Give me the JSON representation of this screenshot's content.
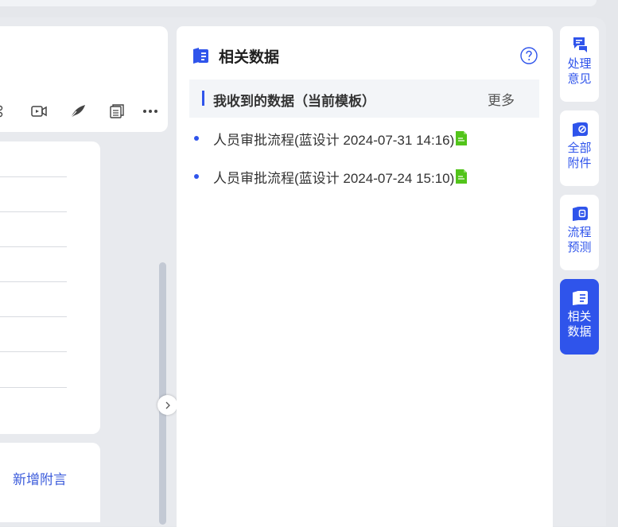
{
  "colors": {
    "accent": "#2f54eb",
    "doc_green": "#52c41a"
  },
  "toolbar": {
    "icons": [
      "org-chart-icon",
      "video-icon",
      "feather-icon",
      "copy-document-icon",
      "more-icon"
    ]
  },
  "form": {
    "add_note_label": "新增附言"
  },
  "panel": {
    "title": "相关数据",
    "section_title": "我收到的数据（当前模板）",
    "more_label": "更多",
    "records": [
      {
        "text": "人员审批流程(蓝设计 2024-07-31 14:16)"
      },
      {
        "text": "人员审批流程(蓝设计 2024-07-24 15:10)"
      }
    ]
  },
  "side_tabs": [
    {
      "label": "处理意见",
      "icon": "comment-flag-icon",
      "active": false
    },
    {
      "label": "全部附件",
      "icon": "attachment-icon",
      "active": false
    },
    {
      "label": "流程预测",
      "icon": "flow-forecast-icon",
      "active": false
    },
    {
      "label": "相关数据",
      "icon": "related-data-icon",
      "active": true
    }
  ]
}
